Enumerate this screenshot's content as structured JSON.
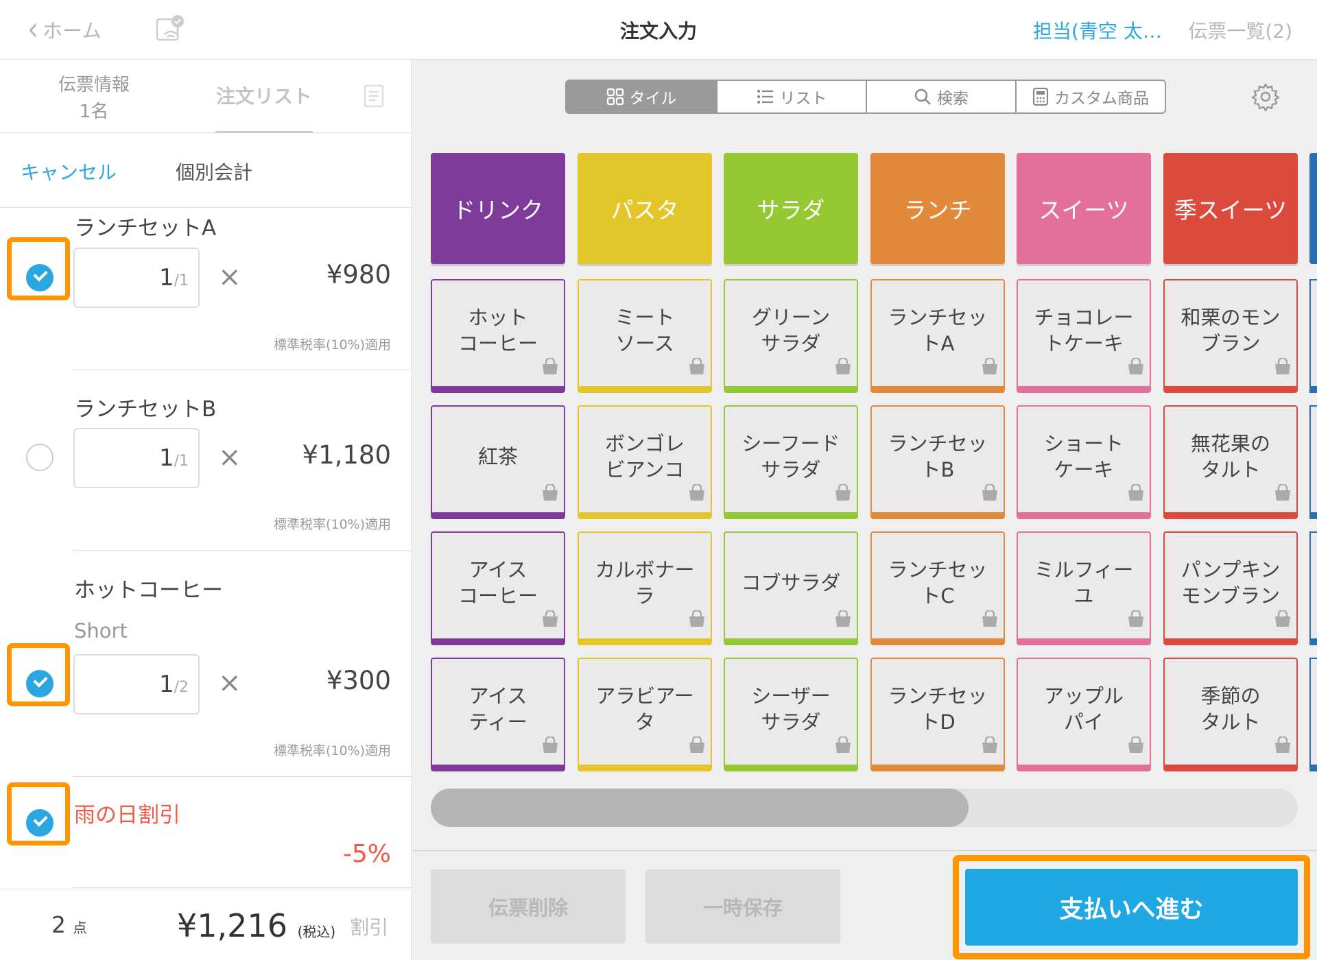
{
  "header": {
    "back_label": "ホーム",
    "title": "注文入力",
    "staff_label": "担当(青空 太…",
    "slip_list_label": "伝票一覧(2)"
  },
  "left_panel": {
    "tabs": {
      "slip_info_label": "伝票情報",
      "slip_info_count": "1名",
      "order_list_label": "注文リスト"
    },
    "actions": {
      "cancel_label": "キャンセル",
      "split_label": "個別会計"
    },
    "items": [
      {
        "name": "ランチセットA",
        "qty": "1",
        "qty_max": "/1",
        "price": "¥980",
        "tax": "標準税率(10%)適用",
        "checked": true
      },
      {
        "name": "ランチセットB",
        "qty": "1",
        "qty_max": "/1",
        "price": "¥1,180",
        "tax": "標準税率(10%)適用",
        "checked": false
      },
      {
        "name": "ホットコーヒー",
        "option": "Short",
        "qty": "1",
        "qty_max": "/2",
        "price": "¥300",
        "tax": "標準税率(10%)適用",
        "checked": true
      }
    ],
    "times_symbol": "×",
    "discount": {
      "name": "雨の日割引",
      "value": "-5%",
      "checked": true
    },
    "footer": {
      "count": "2",
      "count_unit": "点",
      "total": "¥1,216",
      "tax_note": "(税込)",
      "discount_label": "割引"
    }
  },
  "right_panel": {
    "view_tabs": [
      {
        "label": "タイル",
        "icon": "grid-icon",
        "active": true
      },
      {
        "label": "リスト",
        "icon": "list-icon",
        "active": false
      },
      {
        "label": "検索",
        "icon": "search-icon",
        "active": false
      },
      {
        "label": "カスタム商品",
        "icon": "calculator-icon",
        "active": false
      }
    ],
    "categories": [
      {
        "label": "ドリンク",
        "color": "#7e3b99"
      },
      {
        "label": "パスタ",
        "color": "#e3c62a"
      },
      {
        "label": "サラダ",
        "color": "#95c934"
      },
      {
        "label": "ランチ",
        "color": "#e3893a"
      },
      {
        "label": "スイーツ",
        "color": "#e2709a"
      },
      {
        "label": "季スイーツ",
        "color": "#db4a3c"
      }
    ],
    "products": [
      [
        "ホット\nコーヒー",
        "ミート\nソース",
        "グリーン\nサラダ",
        "ランチセッ\nトA",
        "チョコレー\nトケーキ",
        "和栗のモン\nブラン"
      ],
      [
        "紅茶",
        "ボンゴレ\nビアンコ",
        "シーフード\nサラダ",
        "ランチセッ\nトB",
        "ショート\nケーキ",
        "無花果の\nタルト"
      ],
      [
        "アイス\nコーヒー",
        "カルボナー\nラ",
        "コブサラダ",
        "ランチセッ\nトC",
        "ミルフィー\nユ",
        "パンプキン\nモンブラン"
      ],
      [
        "アイス\nティー",
        "アラビアー\nタ",
        "シーザー\nサラダ",
        "ランチセッ\nトD",
        "アップル\nパイ",
        "季節の\nタルト"
      ]
    ],
    "partial_category_color": "#2f6fb0",
    "scroll_position": 0.62,
    "buttons": {
      "delete_label": "伝票削除",
      "hold_label": "一時保存",
      "pay_label": "支払いへ進む"
    }
  }
}
